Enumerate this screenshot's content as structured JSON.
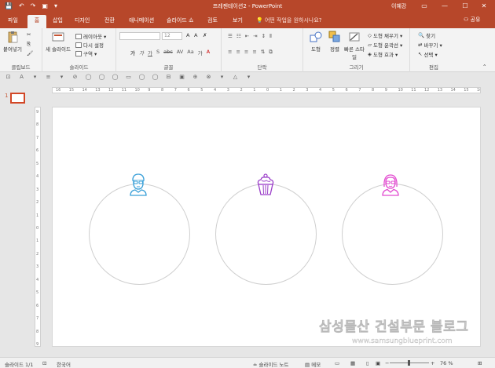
{
  "window": {
    "title": "프레젠테이션2 - PowerPoint",
    "user": "이혜강",
    "buttons": {
      "restore": "▭",
      "minimize": "—",
      "maximize": "☐",
      "close": "✕"
    }
  },
  "qat": {
    "save": "💾",
    "undo": "↶",
    "redo": "↷",
    "start": "▣",
    "more": "▾"
  },
  "tabs": [
    {
      "label": "파일"
    },
    {
      "label": "홈"
    },
    {
      "label": "삽입"
    },
    {
      "label": "디자인"
    },
    {
      "label": "전환"
    },
    {
      "label": "애니메이션"
    },
    {
      "label": "슬라이드 쇼"
    },
    {
      "label": "검토"
    },
    {
      "label": "보기"
    }
  ],
  "tell_me": "💡 어떤 작업을 원하시나요?",
  "share": "⚇ 공유",
  "ribbon": {
    "clipboard": {
      "label": "클립보드",
      "paste": "붙여넣기"
    },
    "slides": {
      "label": "슬라이드",
      "new_slide": "새 슬라이드",
      "layout": "레이아웃 ▾",
      "reset": "다시 설정",
      "section": "구역 ▾"
    },
    "font": {
      "label": "글꼴",
      "size": "12",
      "grow": "A",
      "shrink": "A",
      "clear": "✗",
      "row2": [
        "가",
        "가",
        "가",
        "S",
        "abc",
        "AV",
        "Aa",
        "가",
        "A"
      ]
    },
    "paragraph": {
      "label": "단락"
    },
    "drawing": {
      "label": "그리기",
      "shape": "도형",
      "arrange": "정렬",
      "quick_styles": "빠른 스타일",
      "fill": "도형 채우기 ▾",
      "outline": "도형 윤곽선 ▾",
      "effects": "도형 효과 ▾"
    },
    "editing": {
      "label": "편집",
      "find": "찾기",
      "replace": "바꾸기 ▾",
      "select": "선택 ▾"
    }
  },
  "draw_toolbar": [
    "⊡",
    "A",
    "▾",
    "≡",
    "▾",
    "⊘",
    "◯",
    "◯",
    "◯",
    "▭",
    "◯",
    "◯",
    "⊟",
    "▣",
    "⊕",
    "⊗",
    "▾",
    "△",
    "▾"
  ],
  "thumb": {
    "number": "1"
  },
  "hruler": [
    "16",
    "15",
    "14",
    "13",
    "12",
    "11",
    "10",
    "9",
    "8",
    "7",
    "6",
    "5",
    "4",
    "3",
    "2",
    "1",
    "0",
    "1",
    "2",
    "3",
    "4",
    "5",
    "6",
    "7",
    "8",
    "9",
    "10",
    "11",
    "12",
    "13",
    "14",
    "15",
    "16"
  ],
  "vruler": [
    "9",
    "8",
    "7",
    "6",
    "5",
    "4",
    "3",
    "2",
    "1",
    "0",
    "1",
    "2",
    "3",
    "4",
    "5",
    "6",
    "7",
    "8",
    "9"
  ],
  "slide_icons": {
    "man_color": "#3aa0d8",
    "cupcake_color": "#9b3fc9",
    "woman_color": "#e24bd0"
  },
  "watermark": {
    "line1": "삼성물산 건설부문 블로그",
    "line2": "www.samsungblueprint.com"
  },
  "status": {
    "slide": "슬라이드 1/1",
    "lang": "한국어",
    "notes": "≐ 슬라이드 노트",
    "comments": "▤ 메모",
    "zoom": "76 %"
  }
}
